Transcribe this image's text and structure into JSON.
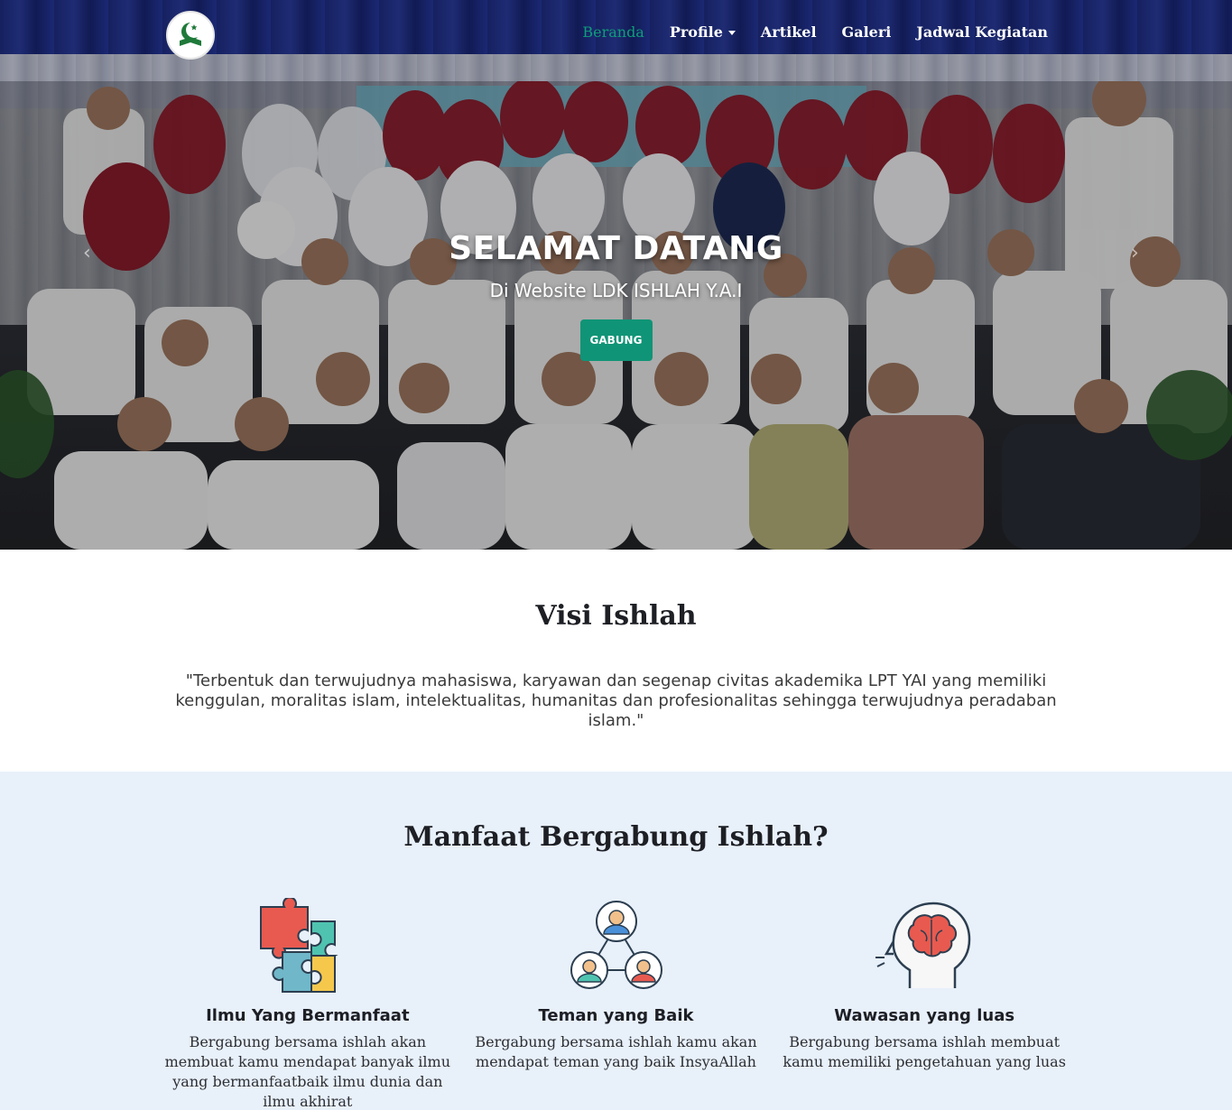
{
  "navbar": {
    "logo_icon": "ishlah-logo-icon",
    "links": [
      {
        "label": "Beranda",
        "active": true
      },
      {
        "label": "Profile",
        "active": false,
        "dropdown": true
      },
      {
        "label": "Artikel",
        "active": false
      },
      {
        "label": "Galeri",
        "active": false
      },
      {
        "label": "Jadwal Kegiatan",
        "active": false
      }
    ]
  },
  "hero": {
    "title": "SELAMAT DATANG",
    "subtitle": "Di Website LDK ISHLAH Y.A.I",
    "button_label": "GABUNG",
    "button_color": "#109477"
  },
  "visi": {
    "title": "Visi Ishlah",
    "text": "\"Terbentuk dan terwujudnya mahasiswa, karyawan dan segenap civitas akademika LPT YAI yang memiliki kenggulan, moralitas islam, intelektualitas, humanitas dan profesionalitas sehingga terwujudnya peradaban islam.\""
  },
  "manfaat": {
    "title": "Manfaat Bergabung Ishlah?",
    "features": [
      {
        "icon": "puzzle-icon",
        "title": "Ilmu Yang Bermanfaat",
        "desc": "Bergabung bersama ishlah akan membuat kamu mendapat banyak ilmu yang bermanfaatbaik ilmu dunia dan ilmu akhirat"
      },
      {
        "icon": "network-people-icon",
        "title": "Teman yang Baik",
        "desc": "Bergabung bersama ishlah kamu akan mendapat teman yang baik InsyaAllah"
      },
      {
        "icon": "brain-head-icon",
        "title": "Wawasan yang luas",
        "desc": "Bergabung bersama ishlah membuat kamu memiliki pengetahuan yang luas"
      }
    ]
  },
  "colors": {
    "accent": "#109477",
    "nav_active": "#0f9d7a",
    "manfaat_bg": "#e8f0fa"
  }
}
